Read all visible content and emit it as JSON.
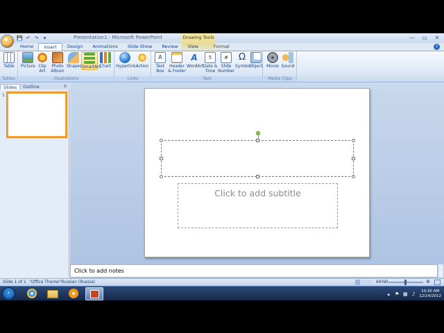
{
  "window": {
    "title": "Presentation1 - Microsoft PowerPoint",
    "contextual_title": "Drawing Tools",
    "controls": {
      "minimize": "—",
      "maximize": "▭",
      "close": "✕"
    }
  },
  "qat": {
    "save": "💾",
    "undo": "↶",
    "redo": "↷",
    "more": "▾"
  },
  "tabs": [
    {
      "label": "Home"
    },
    {
      "label": "Insert"
    },
    {
      "label": "Design"
    },
    {
      "label": "Animations"
    },
    {
      "label": "Slide Show"
    },
    {
      "label": "Review"
    },
    {
      "label": "View"
    },
    {
      "label": "Format"
    }
  ],
  "help": "?",
  "ribbon": {
    "groups": {
      "tables": "Tables",
      "illustrations": "Illustrations",
      "links": "Links",
      "text": "Text",
      "media_clips": "Media Clips"
    },
    "buttons": {
      "table": "Table",
      "picture": "Picture",
      "clip_art": "Clip Art",
      "photo_album": "Photo Album",
      "shapes": "Shapes",
      "smartart": "SmartArt",
      "chart": "Chart",
      "hyperlink": "Hyperlink",
      "action": "Action",
      "text_box": "Text Box",
      "header_footer": "Header & Footer",
      "wordart": "WordArt",
      "date_time": "Date & Time",
      "slide_number": "Slide Number",
      "symbol": "Symbol",
      "object": "Object",
      "movie": "Movie",
      "sound": "Sound"
    }
  },
  "left_pane": {
    "tabs": [
      "Slides",
      "Outline"
    ],
    "close": "x",
    "slide_number": "1"
  },
  "slide": {
    "subtitle_placeholder": "Click to add subtitle"
  },
  "notes": {
    "placeholder": "Click to add notes"
  },
  "status": {
    "slide_info": "Slide 1 of 1",
    "theme": "\"Office Theme\"",
    "language": "Russian (Russia)",
    "zoom": "66%",
    "zoom_minus": "⊖",
    "zoom_plus": "⊕"
  },
  "taskbar": {
    "time": "10:30 AM",
    "date": "12/14/2012"
  },
  "colors": {
    "ribbon_bg": "#dde8f6",
    "selected_thumb_border": "#f1a23b",
    "taskbar": "#1f3860"
  }
}
